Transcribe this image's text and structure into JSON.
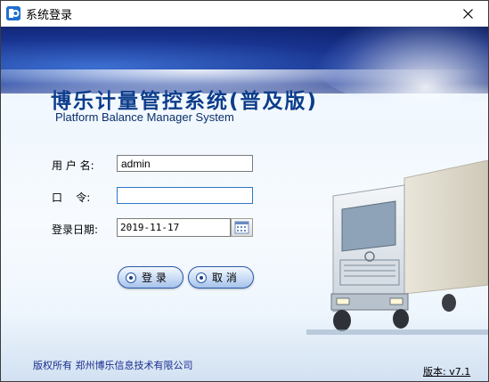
{
  "window": {
    "title": "系统登录",
    "close_icon": "close-icon",
    "app_icon": "app-logo-icon"
  },
  "header": {
    "title": "博乐计量管控系统(普及版)",
    "subtitle": "Platform Balance Manager System"
  },
  "form": {
    "username_label": "用 户 名:",
    "username_value": "admin",
    "password_label": "口    令:",
    "password_value": "",
    "date_label": "登录日期:",
    "date_value": "2019-11-17",
    "calendar_icon": "calendar-icon"
  },
  "buttons": {
    "login_label": "登 录",
    "cancel_label": "取 消"
  },
  "footer": {
    "copyright": "版权所有 郑州博乐信息技术有限公司",
    "version": "版本: v7.1"
  },
  "colors": {
    "title_blue": "#0b3d8c",
    "footer_blue": "#1a2d8f",
    "focus_border": "#2e77c8"
  }
}
